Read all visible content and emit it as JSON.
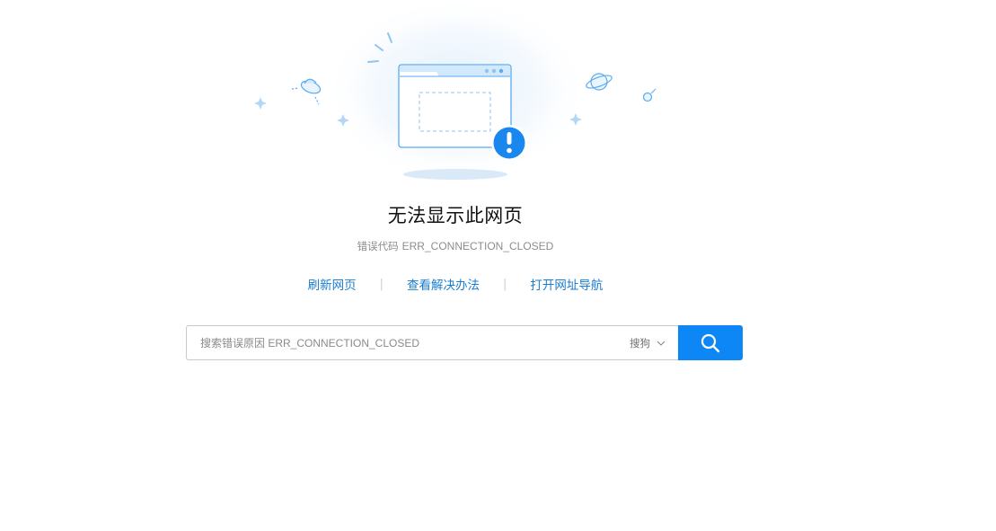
{
  "error_page": {
    "title": "无法显示此网页",
    "error_code_label": "错误代码",
    "error_code": "ERR_CONNECTION_CLOSED"
  },
  "actions": {
    "refresh": "刷新网页",
    "view_solutions": "查看解决办法",
    "open_navigation": "打开网址导航",
    "separator": "|"
  },
  "search": {
    "placeholder": "搜索错误原因 ERR_CONNECTION_CLOSED",
    "engine": "搜狗",
    "button_icon": "search-icon",
    "dropdown_icon": "chevron-down-icon"
  },
  "colors": {
    "accent": "#0d87f5",
    "link": "#1a7dd1",
    "illustration": "#5aaaf0"
  }
}
